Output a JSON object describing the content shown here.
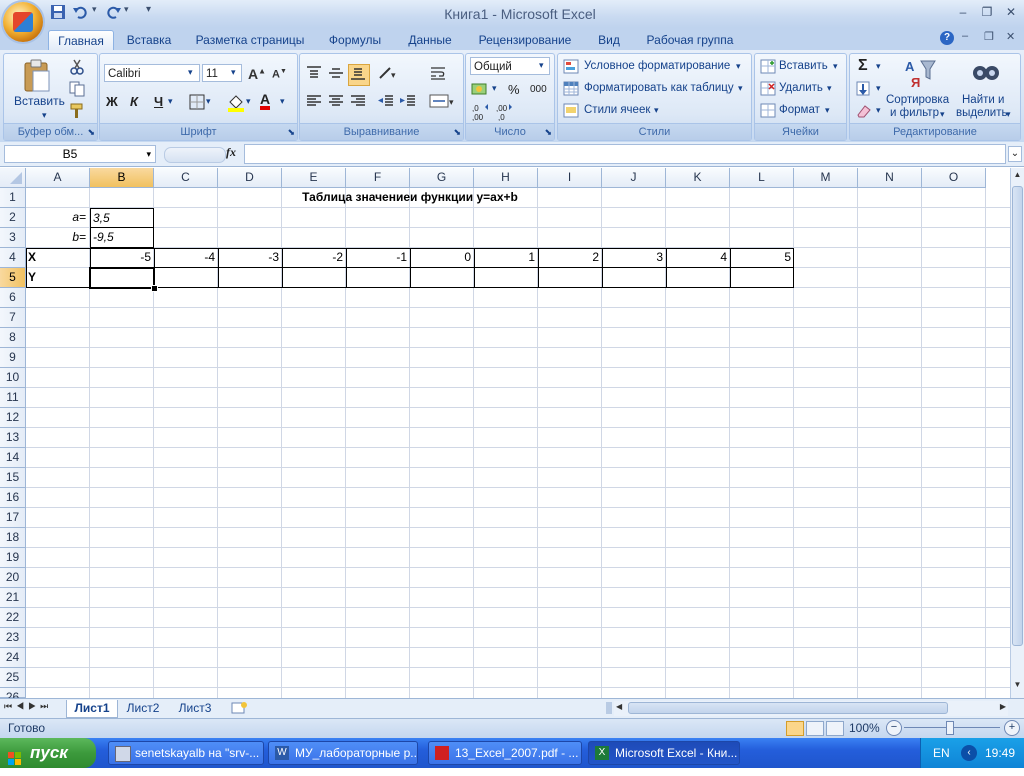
{
  "window": {
    "title": "Книга1 - Microsoft Excel",
    "minimize": "–",
    "restore": "❐",
    "close": "✕"
  },
  "ribbon": {
    "tabs": [
      "Главная",
      "Вставка",
      "Разметка страницы",
      "Формулы",
      "Данные",
      "Рецензирование",
      "Вид",
      "Рабочая группа"
    ],
    "active_tab": "Главная",
    "help": "?",
    "clipboard": {
      "label": "Буфер обм...",
      "paste": "Вставить"
    },
    "font": {
      "label": "Шрифт",
      "name": "Calibri",
      "size": "11",
      "bold": "Ж",
      "italic": "К",
      "underline": "Ч",
      "font_color_glyph": "А"
    },
    "alignment": {
      "label": "Выравнивание"
    },
    "number": {
      "label": "Число",
      "format": "Общий",
      "percent": "%",
      "thousands": "000"
    },
    "styles": {
      "label": "Стили",
      "conditional": "Условное форматирование",
      "as_table": "Форматировать как таблицу",
      "cell_styles": "Стили ячеек"
    },
    "cells": {
      "label": "Ячейки",
      "insert": "Вставить",
      "delete": "Удалить",
      "format": "Формат"
    },
    "editing": {
      "label": "Редактирование",
      "sigma": "Σ",
      "sort_line1": "Сортировка",
      "sort_line2": "и фильтр",
      "find_line1": "Найти и",
      "find_line2": "выделить"
    }
  },
  "formula_bar": {
    "name_box": "B5",
    "fx": "fx",
    "formula": ""
  },
  "sheet": {
    "columns": [
      "A",
      "B",
      "C",
      "D",
      "E",
      "F",
      "G",
      "H",
      "I",
      "J",
      "K",
      "L",
      "M",
      "N",
      "O"
    ],
    "rows": [
      "1",
      "2",
      "3",
      "4",
      "5",
      "6",
      "7",
      "8",
      "9",
      "10",
      "11",
      "12",
      "13",
      "14",
      "15",
      "16",
      "17",
      "18",
      "19",
      "20",
      "21",
      "22",
      "23",
      "24",
      "25",
      "26"
    ],
    "selected_cell": "B5",
    "title": "Таблица значениеи функции y=ax+b",
    "a_label": "a=",
    "a_value": "3,5",
    "b_label": "b=",
    "b_value": "-9,5",
    "x_label": "X",
    "y_label": "Y",
    "x_values": [
      "-5",
      "-4",
      "-3",
      "-2",
      "-1",
      "0",
      "1",
      "2",
      "3",
      "4",
      "5"
    ]
  },
  "sheet_tabs": [
    "Лист1",
    "Лист2",
    "Лист3"
  ],
  "active_sheet": "Лист1",
  "status": {
    "ready": "Готово",
    "zoom": "100%"
  },
  "taskbar": {
    "start": "пуск",
    "items": [
      "senetskayalb на \"srv-...",
      "МУ_лабораторные р...",
      "13_Excel_2007.pdf - ...",
      "Microsoft Excel - Кни..."
    ],
    "lang": "EN",
    "clock": "19:49"
  }
}
